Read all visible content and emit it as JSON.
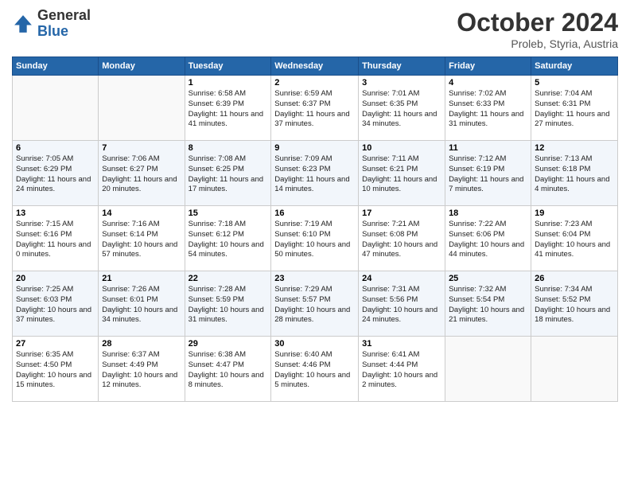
{
  "header": {
    "logo_general": "General",
    "logo_blue": "Blue",
    "month_title": "October 2024",
    "location": "Proleb, Styria, Austria"
  },
  "days_of_week": [
    "Sunday",
    "Monday",
    "Tuesday",
    "Wednesday",
    "Thursday",
    "Friday",
    "Saturday"
  ],
  "weeks": [
    [
      {
        "day": "",
        "info": ""
      },
      {
        "day": "",
        "info": ""
      },
      {
        "day": "1",
        "info": "Sunrise: 6:58 AM\nSunset: 6:39 PM\nDaylight: 11 hours and 41 minutes."
      },
      {
        "day": "2",
        "info": "Sunrise: 6:59 AM\nSunset: 6:37 PM\nDaylight: 11 hours and 37 minutes."
      },
      {
        "day": "3",
        "info": "Sunrise: 7:01 AM\nSunset: 6:35 PM\nDaylight: 11 hours and 34 minutes."
      },
      {
        "day": "4",
        "info": "Sunrise: 7:02 AM\nSunset: 6:33 PM\nDaylight: 11 hours and 31 minutes."
      },
      {
        "day": "5",
        "info": "Sunrise: 7:04 AM\nSunset: 6:31 PM\nDaylight: 11 hours and 27 minutes."
      }
    ],
    [
      {
        "day": "6",
        "info": "Sunrise: 7:05 AM\nSunset: 6:29 PM\nDaylight: 11 hours and 24 minutes."
      },
      {
        "day": "7",
        "info": "Sunrise: 7:06 AM\nSunset: 6:27 PM\nDaylight: 11 hours and 20 minutes."
      },
      {
        "day": "8",
        "info": "Sunrise: 7:08 AM\nSunset: 6:25 PM\nDaylight: 11 hours and 17 minutes."
      },
      {
        "day": "9",
        "info": "Sunrise: 7:09 AM\nSunset: 6:23 PM\nDaylight: 11 hours and 14 minutes."
      },
      {
        "day": "10",
        "info": "Sunrise: 7:11 AM\nSunset: 6:21 PM\nDaylight: 11 hours and 10 minutes."
      },
      {
        "day": "11",
        "info": "Sunrise: 7:12 AM\nSunset: 6:19 PM\nDaylight: 11 hours and 7 minutes."
      },
      {
        "day": "12",
        "info": "Sunrise: 7:13 AM\nSunset: 6:18 PM\nDaylight: 11 hours and 4 minutes."
      }
    ],
    [
      {
        "day": "13",
        "info": "Sunrise: 7:15 AM\nSunset: 6:16 PM\nDaylight: 11 hours and 0 minutes."
      },
      {
        "day": "14",
        "info": "Sunrise: 7:16 AM\nSunset: 6:14 PM\nDaylight: 10 hours and 57 minutes."
      },
      {
        "day": "15",
        "info": "Sunrise: 7:18 AM\nSunset: 6:12 PM\nDaylight: 10 hours and 54 minutes."
      },
      {
        "day": "16",
        "info": "Sunrise: 7:19 AM\nSunset: 6:10 PM\nDaylight: 10 hours and 50 minutes."
      },
      {
        "day": "17",
        "info": "Sunrise: 7:21 AM\nSunset: 6:08 PM\nDaylight: 10 hours and 47 minutes."
      },
      {
        "day": "18",
        "info": "Sunrise: 7:22 AM\nSunset: 6:06 PM\nDaylight: 10 hours and 44 minutes."
      },
      {
        "day": "19",
        "info": "Sunrise: 7:23 AM\nSunset: 6:04 PM\nDaylight: 10 hours and 41 minutes."
      }
    ],
    [
      {
        "day": "20",
        "info": "Sunrise: 7:25 AM\nSunset: 6:03 PM\nDaylight: 10 hours and 37 minutes."
      },
      {
        "day": "21",
        "info": "Sunrise: 7:26 AM\nSunset: 6:01 PM\nDaylight: 10 hours and 34 minutes."
      },
      {
        "day": "22",
        "info": "Sunrise: 7:28 AM\nSunset: 5:59 PM\nDaylight: 10 hours and 31 minutes."
      },
      {
        "day": "23",
        "info": "Sunrise: 7:29 AM\nSunset: 5:57 PM\nDaylight: 10 hours and 28 minutes."
      },
      {
        "day": "24",
        "info": "Sunrise: 7:31 AM\nSunset: 5:56 PM\nDaylight: 10 hours and 24 minutes."
      },
      {
        "day": "25",
        "info": "Sunrise: 7:32 AM\nSunset: 5:54 PM\nDaylight: 10 hours and 21 minutes."
      },
      {
        "day": "26",
        "info": "Sunrise: 7:34 AM\nSunset: 5:52 PM\nDaylight: 10 hours and 18 minutes."
      }
    ],
    [
      {
        "day": "27",
        "info": "Sunrise: 6:35 AM\nSunset: 4:50 PM\nDaylight: 10 hours and 15 minutes."
      },
      {
        "day": "28",
        "info": "Sunrise: 6:37 AM\nSunset: 4:49 PM\nDaylight: 10 hours and 12 minutes."
      },
      {
        "day": "29",
        "info": "Sunrise: 6:38 AM\nSunset: 4:47 PM\nDaylight: 10 hours and 8 minutes."
      },
      {
        "day": "30",
        "info": "Sunrise: 6:40 AM\nSunset: 4:46 PM\nDaylight: 10 hours and 5 minutes."
      },
      {
        "day": "31",
        "info": "Sunrise: 6:41 AM\nSunset: 4:44 PM\nDaylight: 10 hours and 2 minutes."
      },
      {
        "day": "",
        "info": ""
      },
      {
        "day": "",
        "info": ""
      }
    ]
  ]
}
